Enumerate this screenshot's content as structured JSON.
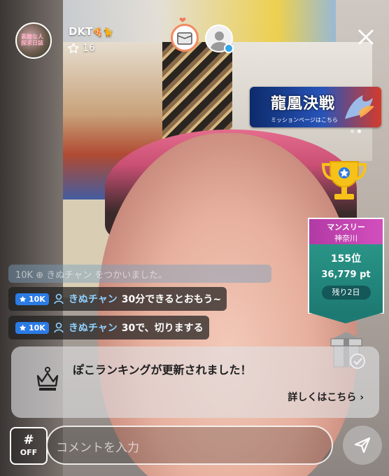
{
  "header": {
    "host_name": "DKT",
    "host_name_emoji": "🍕🐈",
    "follow_count": "16",
    "host_avatar_text": "素敵な人 探求日誌"
  },
  "banner": {
    "title": "龍凰決戦",
    "subtitle": "ミッションページはこちら",
    "page_index": 2,
    "page_count": 2
  },
  "ranking": {
    "title": "マンスリー",
    "area": "神奈川",
    "position": "155位",
    "points": "36,779 pt",
    "days_left": "残り2日"
  },
  "comments": {
    "faded_text": "10K  ⊕ きぬチャン  をつかいました。",
    "items": [
      {
        "level": "10K",
        "user": "きぬチャン",
        "text": "30分できるとおもう~"
      },
      {
        "level": "10K",
        "user": "きぬチャン",
        "text": "30で、切りまする"
      }
    ]
  },
  "notice": {
    "message": "ぽこランキングが更新されました！",
    "link": "詳しくはこちら ›"
  },
  "bottom": {
    "hash_symbol": "#",
    "hash_state": "OFF",
    "input_placeholder": "コメントを入力"
  },
  "colors": {
    "level_badge": "#2c7be5",
    "ranking_header": "#c946b3",
    "ranking_body": "#2a9284",
    "username": "#8fd0ff"
  },
  "icons": [
    "star-outline-icon",
    "close-icon",
    "trophy-icon",
    "gift-icon",
    "crown-icon",
    "send-icon",
    "robot-icon"
  ]
}
